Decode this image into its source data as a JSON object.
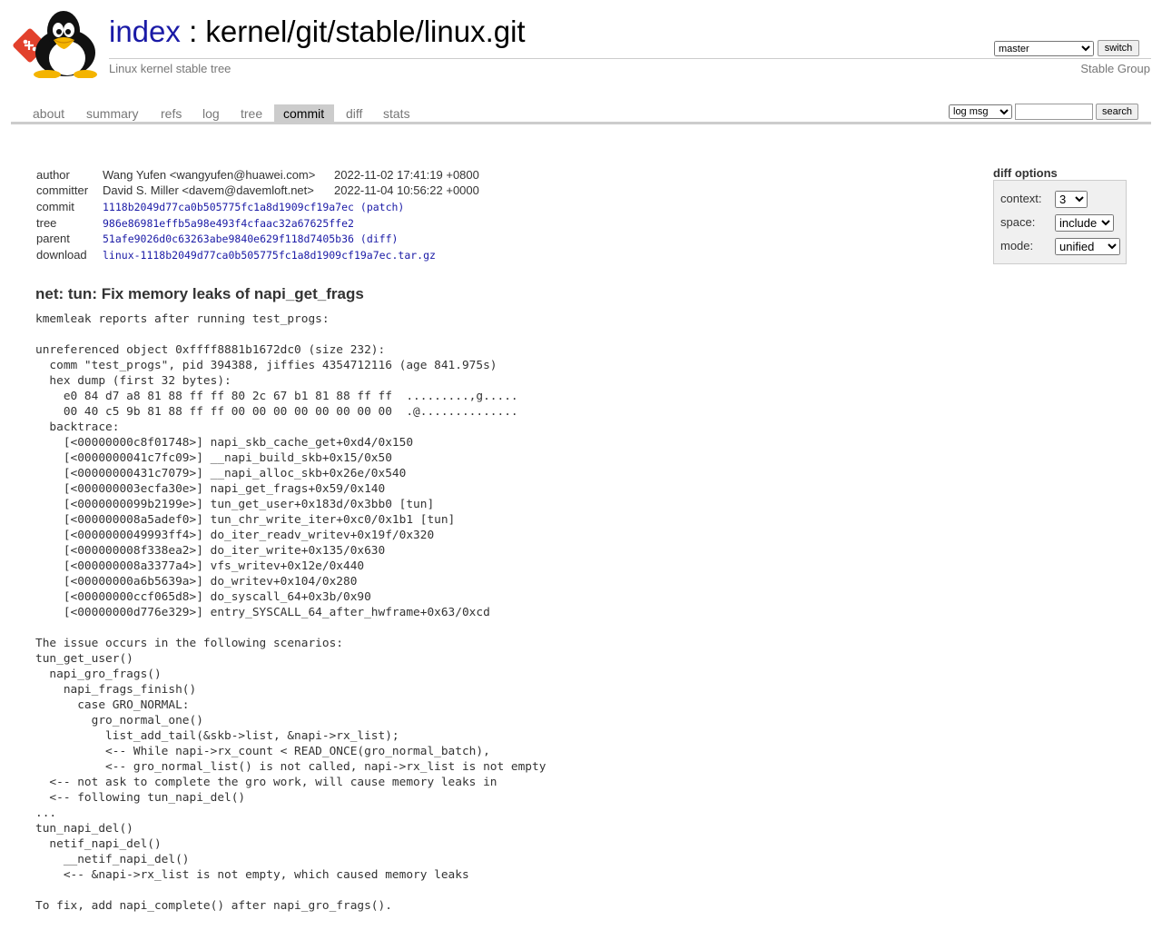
{
  "header": {
    "title_index": "index",
    "title_separator": ":",
    "title_repo": "kernel/git/stable/linux.git",
    "subtitle": "Linux kernel stable tree",
    "owner": "Stable Group",
    "branch": "master",
    "switch_label": "switch"
  },
  "tabs": [
    {
      "label": "about"
    },
    {
      "label": "summary"
    },
    {
      "label": "refs"
    },
    {
      "label": "log"
    },
    {
      "label": "tree"
    },
    {
      "label": "commit"
    },
    {
      "label": "diff"
    },
    {
      "label": "stats"
    }
  ],
  "active_tab": "commit",
  "search": {
    "grep_option": "log msg",
    "search_label": "search",
    "query": ""
  },
  "diff_options": {
    "title": "diff options",
    "context_label": "context:",
    "context_value": "3",
    "space_label": "space:",
    "space_value": "include",
    "mode_label": "mode:",
    "mode_value": "unified"
  },
  "commit_info": {
    "author_label": "author",
    "author": "Wang Yufen <wangyufen@huawei.com>",
    "author_date": "2022-11-02 17:41:19 +0800",
    "committer_label": "committer",
    "committer": "David S. Miller <davem@davemloft.net>",
    "committer_date": "2022-11-04 10:56:22 +0000",
    "commit_label": "commit",
    "commit_hash": "1118b2049d77ca0b505775fc1a8d1909cf19a7ec",
    "patch_link": "(patch)",
    "tree_label": "tree",
    "tree_hash": "986e86981effb5a98e493f4cfaac32a67625ffe2",
    "parent_label": "parent",
    "parent_hash": "51afe9026d0c63263abe9840e629f118d7405b36",
    "diff_link": "(diff)",
    "download_label": "download",
    "download_file": "linux-1118b2049d77ca0b505775fc1a8d1909cf19a7ec.tar.gz"
  },
  "commit_subject": "net: tun: Fix memory leaks of napi_get_frags",
  "commit_message": "kmemleak reports after running test_progs:\n\nunreferenced object 0xffff8881b1672dc0 (size 232):\n  comm \"test_progs\", pid 394388, jiffies 4354712116 (age 841.975s)\n  hex dump (first 32 bytes):\n    e0 84 d7 a8 81 88 ff ff 80 2c 67 b1 81 88 ff ff  .........,g.....\n    00 40 c5 9b 81 88 ff ff 00 00 00 00 00 00 00 00  .@..............\n  backtrace:\n    [<00000000c8f01748>] napi_skb_cache_get+0xd4/0x150\n    [<0000000041c7fc09>] __napi_build_skb+0x15/0x50\n    [<00000000431c7079>] __napi_alloc_skb+0x26e/0x540\n    [<000000003ecfa30e>] napi_get_frags+0x59/0x140\n    [<0000000099b2199e>] tun_get_user+0x183d/0x3bb0 [tun]\n    [<000000008a5adef0>] tun_chr_write_iter+0xc0/0x1b1 [tun]\n    [<0000000049993ff4>] do_iter_readv_writev+0x19f/0x320\n    [<000000008f338ea2>] do_iter_write+0x135/0x630\n    [<000000008a3377a4>] vfs_writev+0x12e/0x440\n    [<00000000a6b5639a>] do_writev+0x104/0x280\n    [<00000000ccf065d8>] do_syscall_64+0x3b/0x90\n    [<00000000d776e329>] entry_SYSCALL_64_after_hwframe+0x63/0xcd\n\nThe issue occurs in the following scenarios:\ntun_get_user()\n  napi_gro_frags()\n    napi_frags_finish()\n      case GRO_NORMAL:\n        gro_normal_one()\n          list_add_tail(&skb->list, &napi->rx_list);\n          <-- While napi->rx_count < READ_ONCE(gro_normal_batch),\n          <-- gro_normal_list() is not called, napi->rx_list is not empty\n  <-- not ask to complete the gro work, will cause memory leaks in\n  <-- following tun_napi_del()\n...\ntun_napi_del()\n  netif_napi_del()\n    __netif_napi_del()\n    <-- &napi->rx_list is not empty, which caused memory leaks\n\nTo fix, add napi_complete() after napi_gro_frags()."
}
